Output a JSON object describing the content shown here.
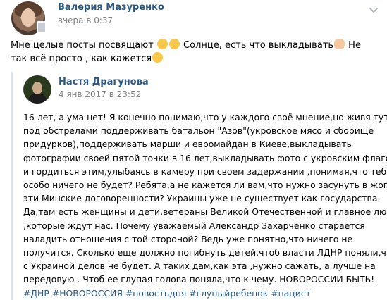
{
  "post": {
    "author": "Валерия Мазуренко",
    "time": "вчера в 0:37",
    "text_part1": "Мне целые посты посвящают ",
    "emoji1": "grinning-emoji",
    "emoji2": "laughing-emoji",
    "text_part2": " Солнце, есть что выкладывать",
    "emoji3": "ok-hand-emoji",
    "text_part3": " Не так всё просто , как кажется",
    "emoji4": "smiling-emoji"
  },
  "repost": {
    "author": "Настя Драгунова",
    "time": "4 янв 2017 в 23:52",
    "lines": [
      "16 лет, а ума нет! Я конечно понимаю,что у каждого своё мнение,но живя тут",
      "под обстрелами поддерживать батальон \"Азов\"(укровское мясо и сборище",
      "придурков),поддерживать марши и евромайдан в Киеве,выкладывать",
      "фотографии своей пятой точки в 16 лет,выкладывать фото с укровским флагом",
      "и гордиться этим,улыбаясь в камеру при своем задержании ,понимая,что тебе",
      "особо ничего не будет? Ребята,а не кажется ли вам,что нужно засунуть в жопу",
      "эти Минские договоренности? Украины уже не существует как государства.",
      "Да,там есть женщины и дети,ветераны Великой Отечественной и главное люди",
      ",которые ждут нас. Почему уважаемый Александр Захарченко старается",
      "наладить отношения с той стороной? Ведь уже понятно,что ничего не",
      "получится. Сколько еще должно погибнуть детей,чтоб власти ЛДНР поняли,что",
      "с Украиной делов не будет. А таких дам,как эта ,нужно сажать, а лучше на",
      "передовую . Чтоб ее глупая голова поняла,что к чему. НОВОРОССИИ БЫТЬ!"
    ],
    "hashtags": [
      "#ДНР",
      "#НОВОРОССИЯ",
      "#новостьдня",
      "#глупыйребенок",
      "#нацист"
    ]
  },
  "colors": {
    "link": "#2a5885",
    "meta": "#828282",
    "repost_bar": "#dae2ea"
  }
}
